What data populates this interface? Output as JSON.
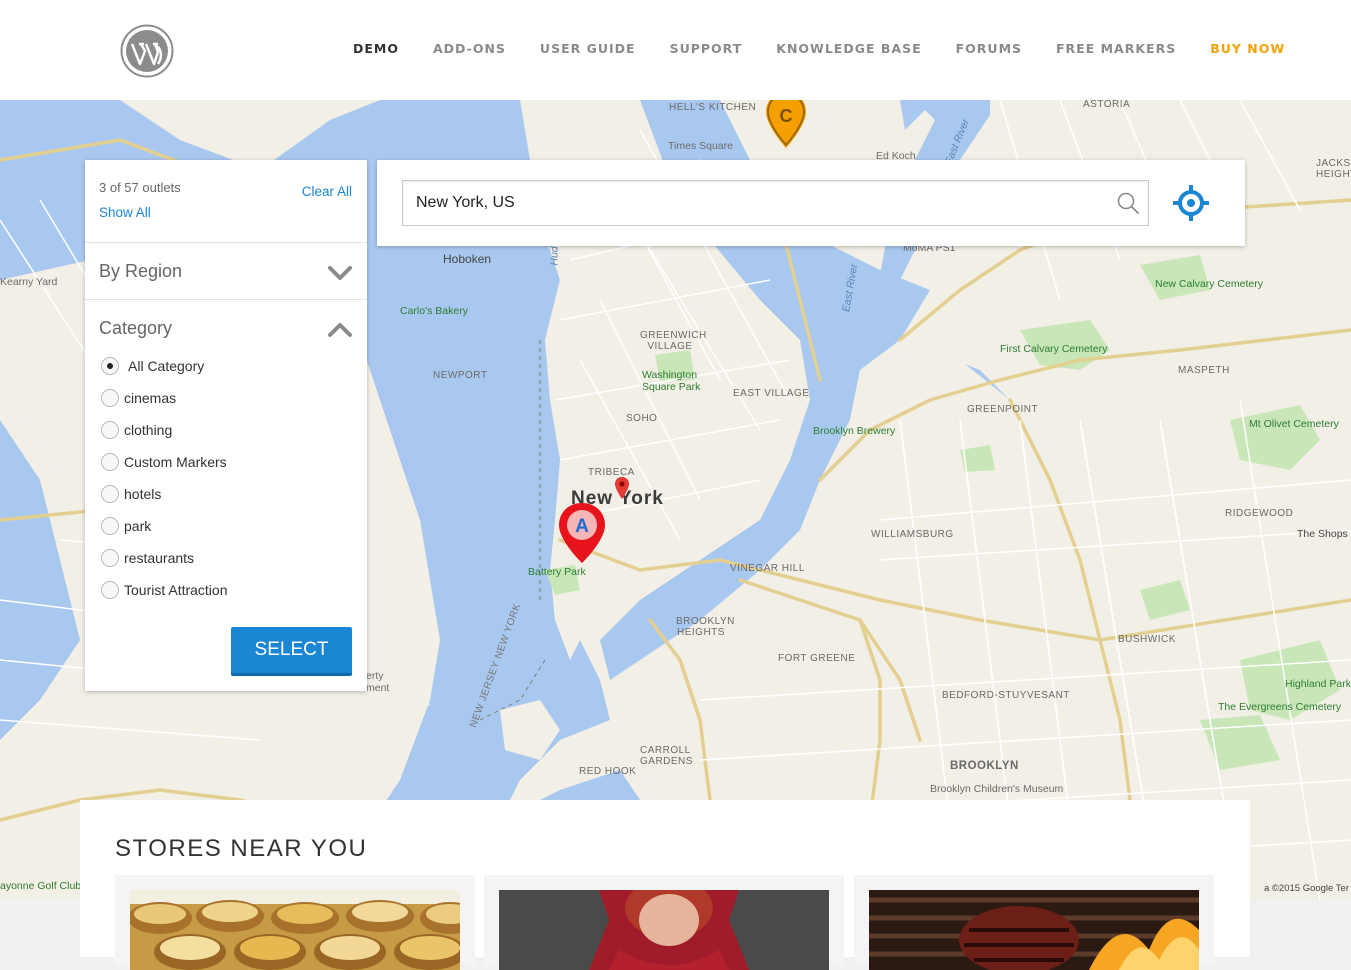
{
  "header": {
    "logo_icon": "wordpress-logo",
    "nav": [
      {
        "label": "DEMO",
        "active": true
      },
      {
        "label": "ADD-ONS"
      },
      {
        "label": "USER GUIDE"
      },
      {
        "label": "SUPPORT"
      },
      {
        "label": "KNOWLEDGE BASE"
      },
      {
        "label": "FORUMS"
      },
      {
        "label": "FREE MARKERS"
      },
      {
        "label": "BUY NOW",
        "accent": "#f0a30a"
      }
    ]
  },
  "filter": {
    "outlets_text": "3 of 57 outlets",
    "show_all": "Show All",
    "clear_all": "Clear All",
    "by_region": "By Region",
    "category": "Category",
    "categories": [
      {
        "label": "All Category",
        "selected": true
      },
      {
        "label": "cinemas"
      },
      {
        "label": "clothing"
      },
      {
        "label": "Custom Markers"
      },
      {
        "label": "hotels"
      },
      {
        "label": "park"
      },
      {
        "label": "restaurants"
      },
      {
        "label": "Tourist Attraction"
      }
    ],
    "select_button": "SELECT",
    "accent": "#1a86d4"
  },
  "search": {
    "value": "New York, US",
    "search_icon": "magnifier-icon",
    "locate_icon": "crosshair-locate-icon"
  },
  "map": {
    "markers": [
      {
        "letter": "A",
        "color": "#e8141b"
      },
      {
        "letter": "C",
        "color": "#f5a000"
      }
    ],
    "labels": {
      "new_york": "New York",
      "hells_kitchen": "HELL'S KITCHEN",
      "times_square": "Times Square",
      "astoria": "ASTORIA",
      "hoboken": "Hoboken",
      "kearny_yard": "Kearny Yard",
      "carlos_bakery": "Carlo's Bakery",
      "greenwich_village": "GREENWICH VILLAGE",
      "washington_square_park": "Washington Square Park",
      "east_village": "EAST VILLAGE",
      "soho": "SOHO",
      "tribeca": "TRIBECA",
      "newport": "NEWPORT",
      "battery_park": "Battery Park",
      "brooklyn_brewery": "Brooklyn Brewery",
      "williamsburg": "WILLIAMSBURG",
      "greenpoint": "GREENPOINT",
      "first_calvary": "First Calvary Cemetery",
      "new_calvary": "New Calvary Cemetery",
      "maspeth": "MASPETH",
      "mt_olivet": "Mt Olivet Cemetery",
      "ridgewood": "RIDGEWOOD",
      "the_shops": "The Shops",
      "bushwick": "BUSHWICK",
      "highland_park": "Highland Park",
      "evergreens": "The Evergreens Cemetery",
      "bed_stuy": "BEDFORD-STUYVESANT",
      "brooklyn": "BROOKLYN",
      "fort_greene": "FORT GREENE",
      "vinegar_hill": "VINEGAR HILL",
      "brooklyn_heights": "BROOKLYN HEIGHTS",
      "carroll_gardens": "CARROLL GARDENS",
      "red_hook": "RED HOOK",
      "jackson_heights": "JACKSO HEIGHT",
      "moma": "MoMA PS1",
      "fd_koch": "Ed Koch",
      "bayonne": "ayonne Golf Club",
      "brooklyn_museum": "Brooklyn Children's Museum",
      "liberty": "erty ment",
      "east_river": "East River",
      "hudson": "Hud",
      "nj_ny": "NEW JERSEY NEW YORK",
      "copyright": "a ©2015 Google   Ter"
    }
  },
  "stores": {
    "title": "STORES NEAR YOU"
  }
}
